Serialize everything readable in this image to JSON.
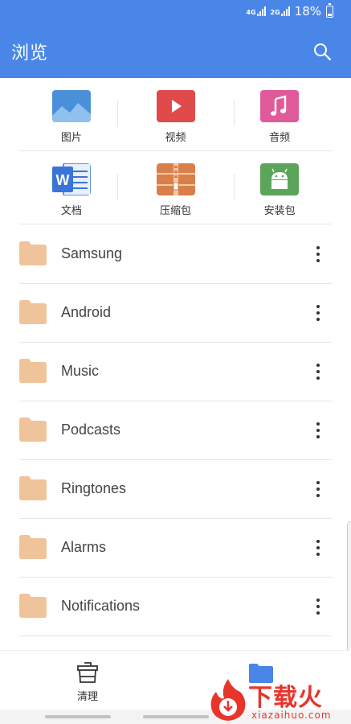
{
  "status_bar": {
    "network_top": "4G",
    "network_2": "2G",
    "battery_text": "18%"
  },
  "header": {
    "title": "浏览",
    "search_icon": "search-icon"
  },
  "categories": [
    {
      "label": "图片",
      "icon": "image-icon",
      "color": "#4a90d9"
    },
    {
      "label": "视频",
      "icon": "video-play-icon",
      "color": "#e04a4a"
    },
    {
      "label": "音频",
      "icon": "music-note-icon",
      "color": "#e05a9a"
    },
    {
      "label": "文档",
      "icon": "word-document-icon",
      "color": "#3a74d8"
    },
    {
      "label": "压缩包",
      "icon": "archive-zip-icon",
      "color": "#d9804a"
    },
    {
      "label": "安装包",
      "icon": "android-apk-icon",
      "color": "#5aa55a"
    }
  ],
  "folders": [
    {
      "name": "Samsung"
    },
    {
      "name": "Android"
    },
    {
      "name": "Music"
    },
    {
      "name": "Podcasts"
    },
    {
      "name": "Ringtones"
    },
    {
      "name": "Alarms"
    },
    {
      "name": "Notifications"
    }
  ],
  "colors": {
    "accent": "#4a86e8",
    "folder": "#f0c49a"
  },
  "bottom_nav": {
    "clean_label": "清理"
  },
  "watermark": {
    "title": "下载火",
    "subtitle": "xiazaihuo.com"
  }
}
